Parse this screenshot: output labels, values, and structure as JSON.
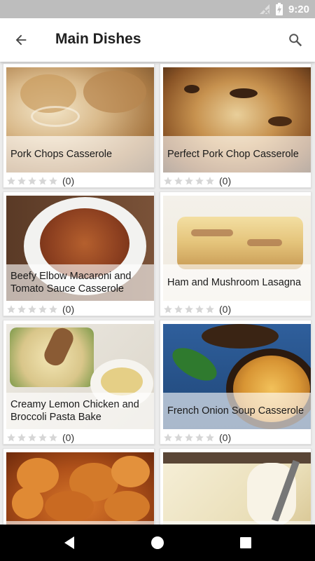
{
  "status_bar": {
    "time": "9:20",
    "icons": [
      "signal-off-icon",
      "battery-charging-icon"
    ]
  },
  "app_bar": {
    "title": "Main Dishes",
    "back_icon": "arrow-back-icon",
    "search_icon": "search-icon"
  },
  "recipes": [
    {
      "title": "Pork Chops Casserole",
      "rating_count": "(0)",
      "stars": 0
    },
    {
      "title": "Perfect Pork Chop Casserole",
      "rating_count": "(0)",
      "stars": 0
    },
    {
      "title": "Beefy Elbow Macaroni and Tomato Sauce Casserole",
      "rating_count": "(0)",
      "stars": 0
    },
    {
      "title": "Ham and Mushroom Lasagna",
      "rating_count": "(0)",
      "stars": 0
    },
    {
      "title": "Creamy Lemon Chicken and Broccoli Pasta Bake",
      "rating_count": "(0)",
      "stars": 0
    },
    {
      "title": "French Onion Soup Casserole",
      "rating_count": "(0)",
      "stars": 0
    },
    {
      "title": "",
      "rating_count": "",
      "stars": 0
    },
    {
      "title": "",
      "rating_count": "",
      "stars": 0
    }
  ],
  "nav_bar": {
    "icons": [
      "back-triangle-icon",
      "home-circle-icon",
      "recents-square-icon"
    ]
  },
  "colors": {
    "status_bar": "#bdbdbd",
    "app_bar": "#ffffff",
    "background": "#ececec",
    "star_empty": "#d6d6d6",
    "nav_bar": "#000000"
  }
}
